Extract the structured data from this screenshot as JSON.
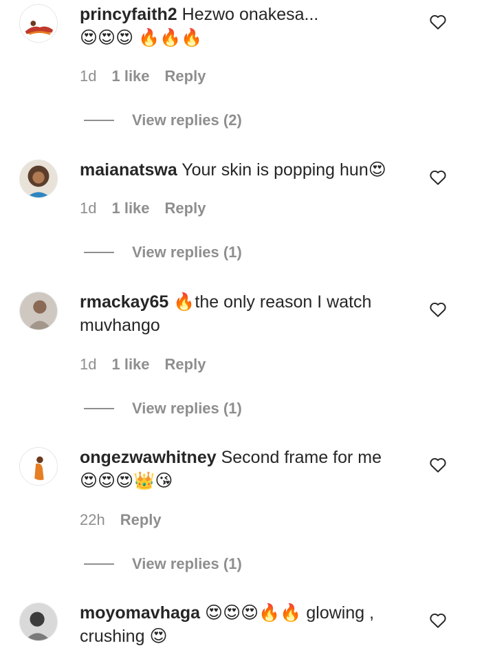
{
  "icons": {
    "like": "heart-outline-icon"
  },
  "comments": [
    {
      "username": "princyfaith2",
      "text": " Hezwo onakesa... ",
      "emojis": "😍😍😍 🔥🔥🔥",
      "time": "1d",
      "likes": "1 like",
      "reply_label": "Reply",
      "view_replies": "View replies (2)"
    },
    {
      "username": "maianatswa",
      "text": " Your skin is popping hun",
      "emojis": "😍",
      "time": "1d",
      "likes": "1 like",
      "reply_label": "Reply",
      "view_replies": "View replies (1)"
    },
    {
      "username": "rmackay65",
      "text": " 🔥the only reason I watch muvhango",
      "emojis": "",
      "time": "1d",
      "likes": "1 like",
      "reply_label": "Reply",
      "view_replies": "View replies (1)"
    },
    {
      "username": "ongezwawhitney",
      "text": " Second frame for me ",
      "emojis": "😍😍😍👑😘",
      "time": "22h",
      "likes": "",
      "reply_label": "Reply",
      "view_replies": "View replies (1)"
    },
    {
      "username": "moyomavhaga",
      "text": " 😍😍😍🔥🔥 glowing , crushing ",
      "emojis": "😍",
      "time": "",
      "likes": "",
      "reply_label": "",
      "view_replies": ""
    }
  ]
}
